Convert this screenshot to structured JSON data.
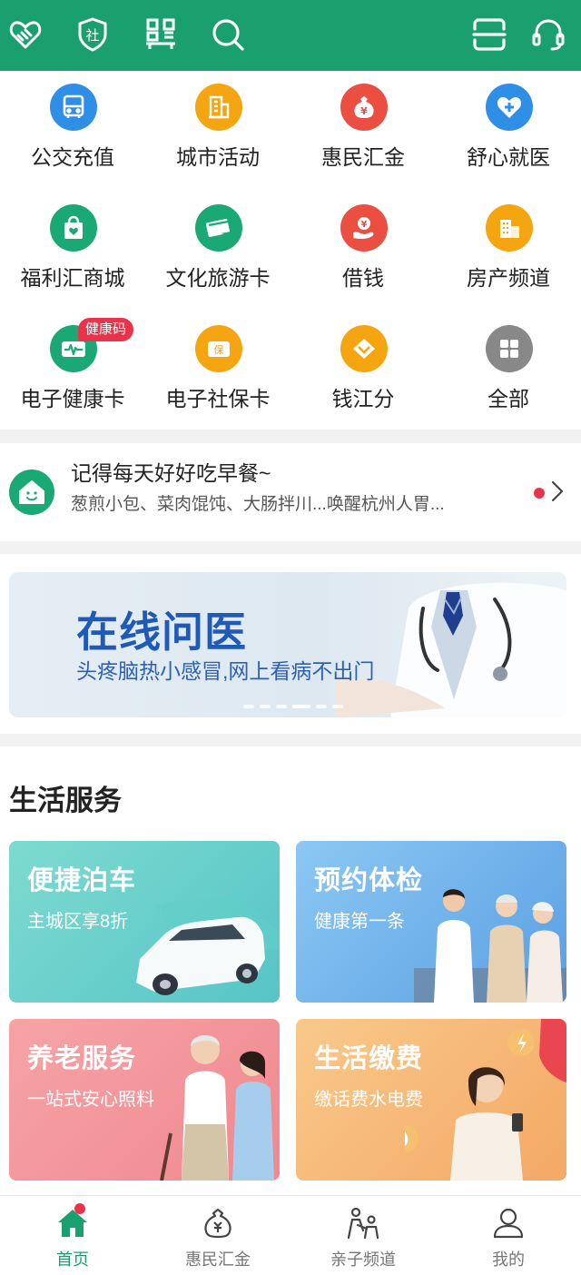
{
  "colors": {
    "brand": "#1aa06e",
    "alert": "#e8334a"
  },
  "topbar": {
    "left_icons": [
      "handshake-icon",
      "social-security-shield-icon",
      "qr-code-icon",
      "search-icon"
    ],
    "right_icons": [
      "scan-icon",
      "customer-service-icon"
    ],
    "shield_glyph": "社"
  },
  "grid": {
    "items": [
      {
        "label": "公交充值",
        "icon": "bus-icon",
        "color": "#2f8ee5"
      },
      {
        "label": "城市活动",
        "icon": "building-icon",
        "color": "#f5a510"
      },
      {
        "label": "惠民汇金",
        "icon": "money-bag-icon",
        "color": "#ea4f42",
        "glyph": "¥"
      },
      {
        "label": "舒心就医",
        "icon": "medical-heart-icon",
        "color": "#2f8ee5"
      },
      {
        "label": "福利汇商城",
        "icon": "shopping-bag-icon",
        "color": "#1aa874"
      },
      {
        "label": "文化旅游卡",
        "icon": "travel-card-icon",
        "color": "#1aa874"
      },
      {
        "label": "借钱",
        "icon": "loan-hand-icon",
        "color": "#ea4f42",
        "glyph": "¥"
      },
      {
        "label": "房产频道",
        "icon": "house-building-icon",
        "color": "#f5a510"
      },
      {
        "label": "电子健康卡",
        "icon": "health-card-icon",
        "color": "#1aa874",
        "badge": "健康码"
      },
      {
        "label": "电子社保卡",
        "icon": "social-card-icon",
        "color": "#f5a510",
        "glyph": "保"
      },
      {
        "label": "钱江分",
        "icon": "diamond-icon",
        "color": "#f5a510"
      },
      {
        "label": "全部",
        "icon": "all-grid-icon",
        "color": "#888888"
      }
    ]
  },
  "notice": {
    "title": "记得每天好好吃早餐~",
    "subtitle": "葱煎小包、菜肉馄饨、大肠拌川...唤醒杭州人胃..."
  },
  "banner": {
    "title": "在线问医",
    "subtitle": "头疼脑热小感冒,网上看病不出门",
    "page_count": 6,
    "active_page": 4
  },
  "life": {
    "title": "生活服务",
    "cards": [
      {
        "title": "便捷泊车",
        "subtitle": "主城区享8折",
        "illustration": "car-illustration",
        "bg": "#6fd5c8"
      },
      {
        "title": "预约体检",
        "subtitle": "健康第一条",
        "illustration": "doctor-elderly-illustration",
        "bg": "#7cb9ee"
      },
      {
        "title": "养老服务",
        "subtitle": "一站式安心照料",
        "illustration": "elderly-care-illustration",
        "bg": "#f49a9e"
      },
      {
        "title": "生活缴费",
        "subtitle": "缴话费水电费",
        "illustration": "woman-phone-illustration",
        "bg": "#f7b774"
      }
    ]
  },
  "tabbar": {
    "tabs": [
      {
        "label": "首页",
        "icon": "home-icon",
        "active": true
      },
      {
        "label": "惠民汇金",
        "icon": "money-bag-icon"
      },
      {
        "label": "亲子频道",
        "icon": "family-icon"
      },
      {
        "label": "我的",
        "icon": "user-icon"
      }
    ]
  }
}
